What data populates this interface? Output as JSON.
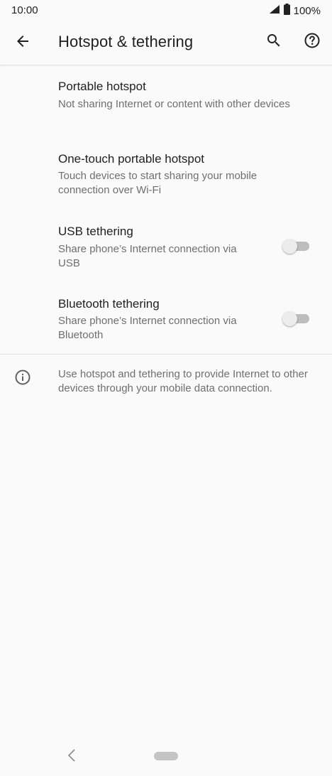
{
  "status_bar": {
    "time": "10:00",
    "battery_percent": "100%",
    "signal_icon": "signal-icon",
    "battery_icon": "battery-icon"
  },
  "app_bar": {
    "title": "Hotspot & tethering",
    "back_icon": "arrow-back-icon",
    "search_icon": "search-icon",
    "help_icon": "help-icon"
  },
  "settings": [
    {
      "title": "Portable hotspot",
      "summary": "Not sharing Internet or content with other devices",
      "has_switch": false
    },
    {
      "title": "One-touch portable hotspot",
      "summary": "Touch devices to start sharing your mobile connection over Wi-Fi",
      "has_switch": false
    },
    {
      "title": "USB tethering",
      "summary": "Share phone’s Internet connection via USB",
      "has_switch": true,
      "switch_on": false
    },
    {
      "title": "Bluetooth tethering",
      "summary": "Share phone’s Internet connection via Bluetooth",
      "has_switch": true,
      "switch_on": false
    }
  ],
  "footer": {
    "info_icon": "info-icon",
    "text": "Use hotspot and tethering to provide Internet to other devices through your mobile data connection."
  },
  "nav_bar": {
    "back_icon": "nav-back-icon",
    "home_icon": "nav-home-pill"
  },
  "colors": {
    "background": "#fafafa",
    "title_text": "#202124",
    "secondary_text": "#6f6f6f",
    "switch_track_off": "#bdbdbd",
    "switch_thumb_off": "#ececec"
  }
}
